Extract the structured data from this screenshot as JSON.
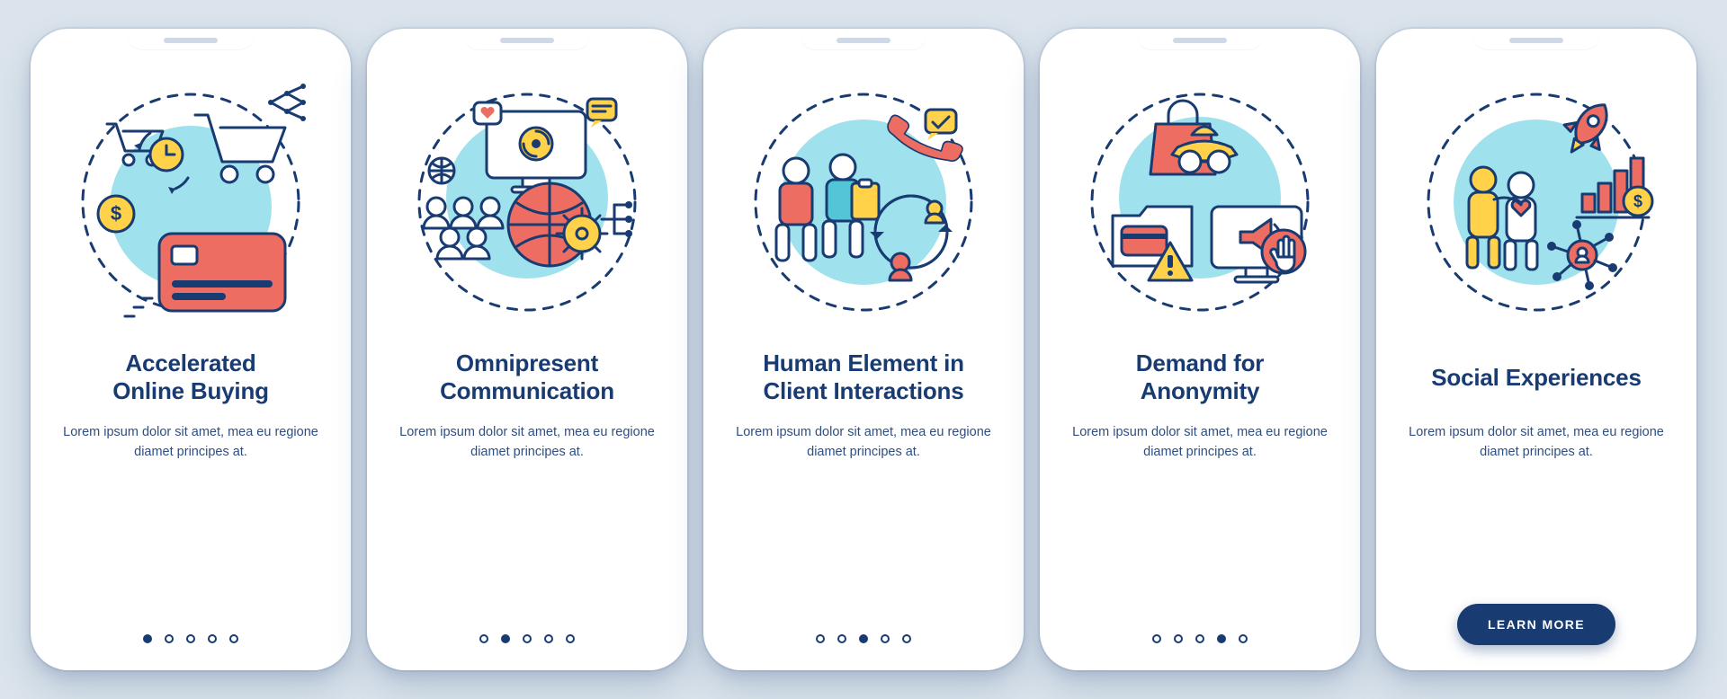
{
  "colors": {
    "navy": "#183b72",
    "coral": "#ee6d62",
    "yellow": "#ffd24a",
    "sky": "#9fe1ec",
    "background": "#dbe4ec",
    "card": "#ffffff"
  },
  "pager": {
    "count": 5
  },
  "slides": [
    {
      "icon": "online-buying",
      "title": "Accelerated\nOnline Buying",
      "description": "Lorem ipsum dolor sit amet, mea eu regione diamet principes at.",
      "activeIndex": 0,
      "showCta": false
    },
    {
      "icon": "omnipresent-communication",
      "title": "Omnipresent\nCommunication",
      "description": "Lorem ipsum dolor sit amet, mea eu regione diamet principes at.",
      "activeIndex": 1,
      "showCta": false
    },
    {
      "icon": "human-client-interactions",
      "title": "Human Element in\nClient Interactions",
      "description": "Lorem ipsum dolor sit amet, mea eu regione diamet principes at.",
      "activeIndex": 2,
      "showCta": false
    },
    {
      "icon": "demand-for-anonymity",
      "title": "Demand for\nAnonymity",
      "description": "Lorem ipsum dolor sit amet, mea eu regione diamet principes at.",
      "activeIndex": 3,
      "showCta": false
    },
    {
      "icon": "social-experiences",
      "title": "Social Experiences",
      "description": "Lorem ipsum dolor sit amet, mea eu regione diamet principes at.",
      "activeIndex": 4,
      "showCta": true
    }
  ],
  "cta": {
    "label": "LEARN MORE"
  }
}
